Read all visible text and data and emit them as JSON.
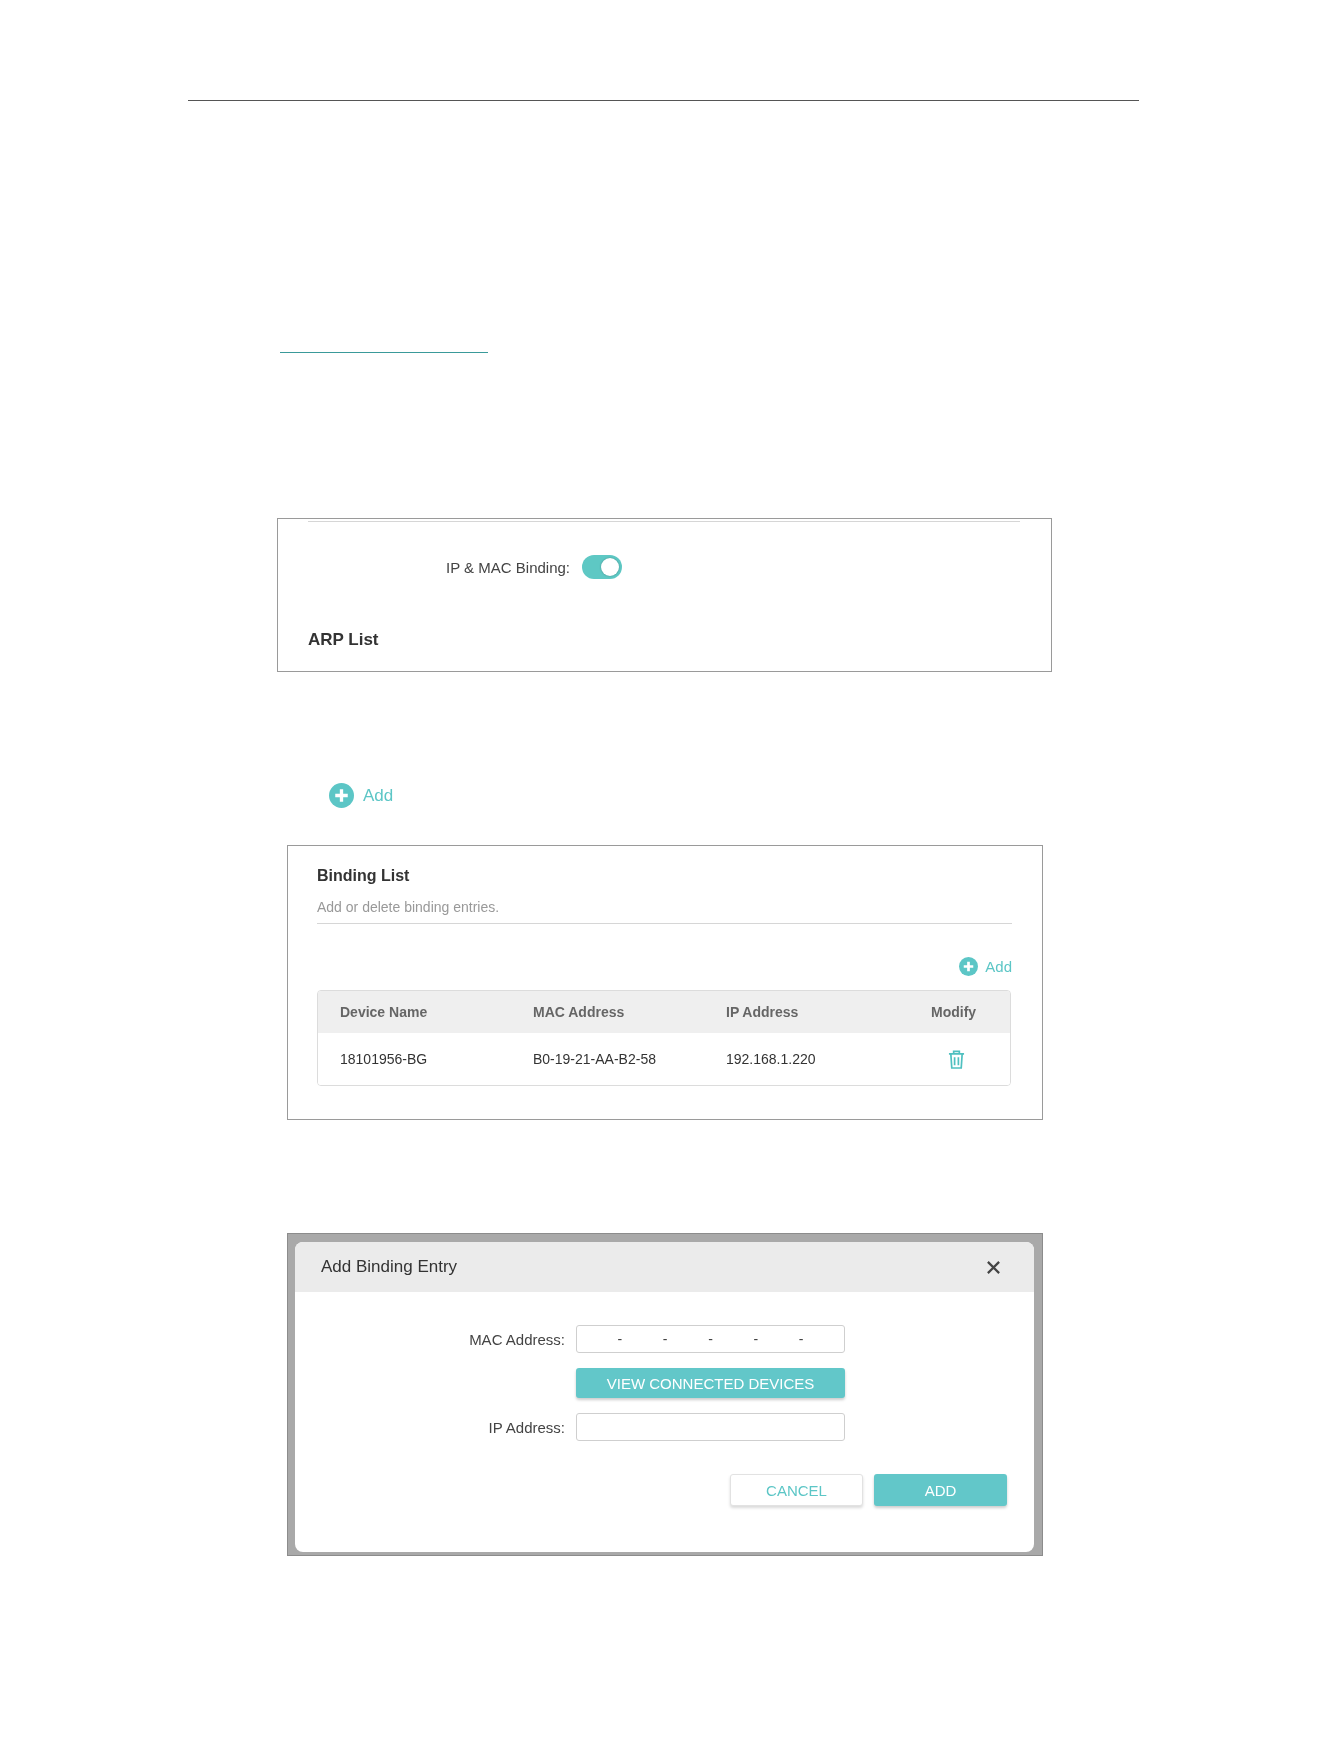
{
  "arp_screenshot": {
    "binding_label": "IP & MAC Binding:",
    "binding_on": true,
    "section_title": "ARP List"
  },
  "add_link": {
    "label": "Add"
  },
  "binding_list": {
    "title": "Binding List",
    "description": "Add or delete binding entries.",
    "add_label": "Add",
    "columns": [
      "Device Name",
      "MAC Address",
      "IP Address",
      "Modify"
    ],
    "rows": [
      {
        "device_name": "18101956-BG",
        "mac_address": "B0-19-21-AA-B2-58",
        "ip_address": "192.168.1.220"
      }
    ]
  },
  "dialog": {
    "title": "Add Binding Entry",
    "mac_label": "MAC Address:",
    "mac_separators": [
      "-",
      "-",
      "-",
      "-",
      "-"
    ],
    "view_button": "VIEW CONNECTED DEVICES",
    "ip_label": "IP Address:",
    "buttons": [
      {
        "label": "CANCEL",
        "kind": "secondary"
      },
      {
        "label": "ADD",
        "kind": "primary"
      }
    ]
  }
}
